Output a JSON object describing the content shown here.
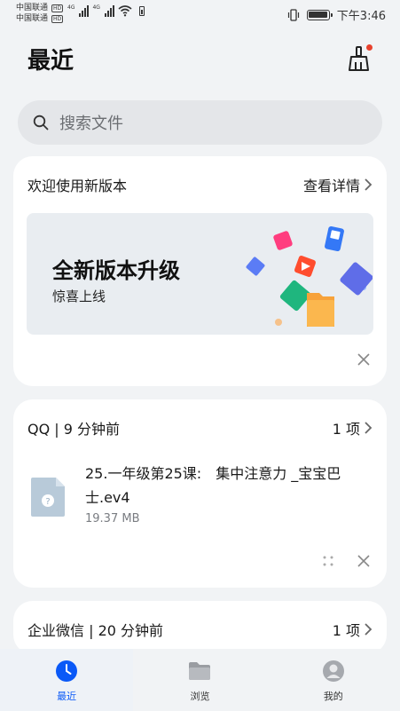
{
  "status_bar": {
    "carrier1": "中国联通",
    "carrier2": "中国联通",
    "hd": "HD",
    "net": "4G",
    "time": "下午3:46"
  },
  "header": {
    "title": "最近",
    "cleaner_icon": "broom-icon"
  },
  "search": {
    "placeholder": "搜索文件",
    "icon": "search-icon"
  },
  "promo_card": {
    "title": "欢迎使用新版本",
    "action": "查看详情",
    "banner_title": "全新版本升级",
    "banner_subtitle": "惊喜上线"
  },
  "qq_card": {
    "source": "QQ",
    "time_ago": "9 分钟前",
    "count": "1 项",
    "file": {
      "name": "25.一年级第25课:　集中注意力 _宝宝巴士.ev4",
      "size": "19.37 MB",
      "icon": "unknown-file-icon"
    }
  },
  "wework_card": {
    "source": "企业微信",
    "time_ago": "20 分钟前",
    "count": "1 项"
  },
  "bottom_nav": {
    "items": [
      {
        "label": "最近",
        "icon": "clock-icon",
        "active": true
      },
      {
        "label": "浏览",
        "icon": "folder-icon",
        "active": false
      },
      {
        "label": "我的",
        "icon": "profile-icon",
        "active": false
      }
    ]
  },
  "colors": {
    "accent": "#0a59f7",
    "background": "#f1f3f5",
    "card": "#ffffff",
    "badge": "#e8412d"
  }
}
